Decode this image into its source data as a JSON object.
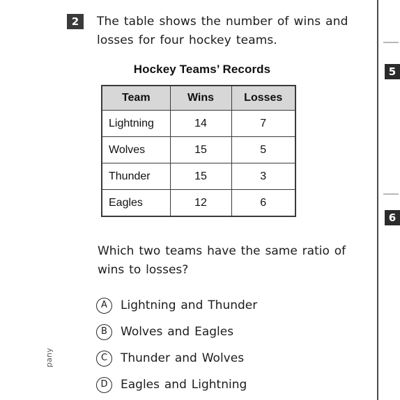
{
  "question": {
    "number": "2",
    "stem": "The table shows the number of wins and losses for four hockey teams.",
    "prompt": "Which two teams have the same ratio of wins to losses?"
  },
  "table": {
    "title": "Hockey Teams’ Records",
    "headers": [
      "Team",
      "Wins",
      "Losses"
    ],
    "rows": [
      {
        "team": "Lightning",
        "wins": "14",
        "losses": "7"
      },
      {
        "team": "Wolves",
        "wins": "15",
        "losses": "5"
      },
      {
        "team": "Thunder",
        "wins": "15",
        "losses": "3"
      },
      {
        "team": "Eagles",
        "wins": "12",
        "losses": "6"
      }
    ]
  },
  "choices": [
    {
      "letter": "A",
      "text": "Lightning and Thunder"
    },
    {
      "letter": "B",
      "text": "Wolves and Eagles"
    },
    {
      "letter": "C",
      "text": "Thunder and Wolves"
    },
    {
      "letter": "D",
      "text": "Eagles and Lightning"
    }
  ],
  "next_column": {
    "badges": [
      "5",
      "6"
    ]
  },
  "footer": {
    "copyright_fragment": "pany"
  }
}
